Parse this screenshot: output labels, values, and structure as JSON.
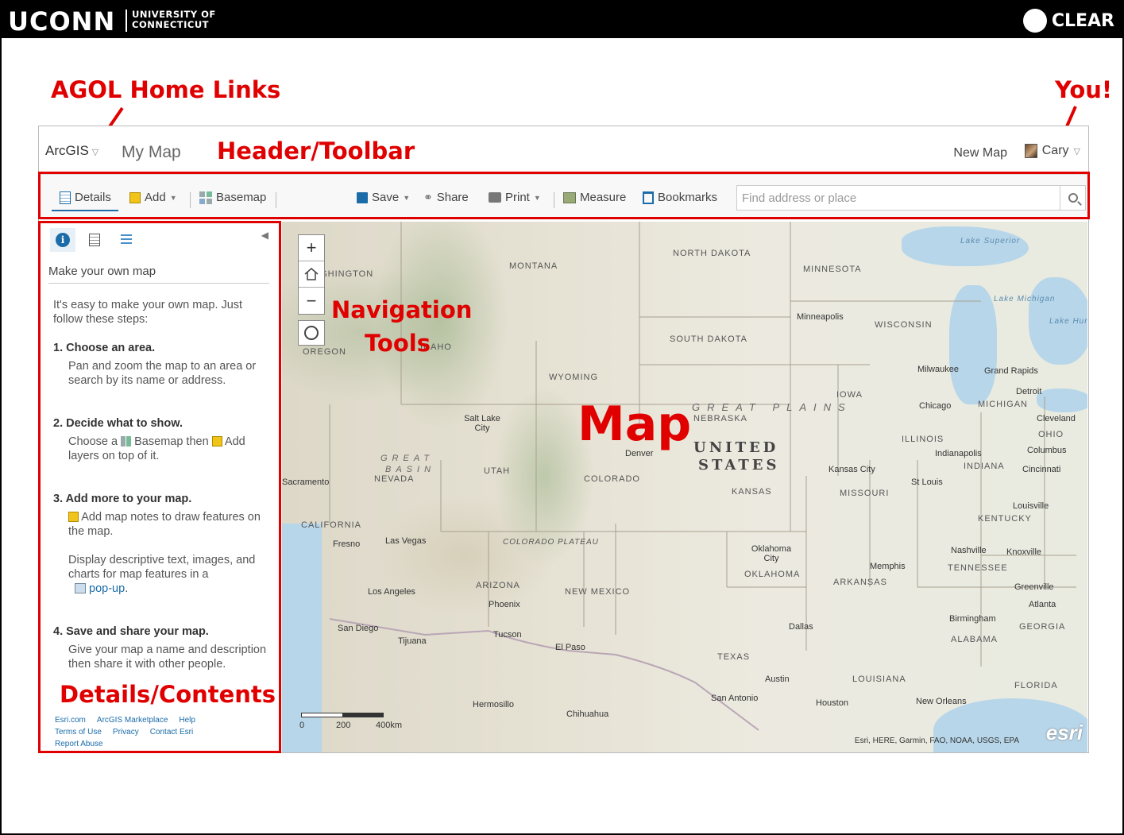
{
  "slide": {
    "brand_main": "UCONN",
    "brand_sub_line1": "UNIVERSITY OF",
    "brand_sub_line2": "CONNECTICUT",
    "clear_logo": "CLEAR"
  },
  "annotations": {
    "agol": "AGOL Home Links",
    "you": "You!",
    "header": "Header/Toolbar",
    "nav": "Navigation",
    "nav2": "Tools",
    "map": "Map",
    "details": "Details/Contents"
  },
  "header": {
    "arcgis": "ArcGIS",
    "title": "My Map",
    "new_map": "New Map",
    "user": "Cary"
  },
  "toolbar": {
    "details": "Details",
    "add": "Add",
    "basemap": "Basemap",
    "save": "Save",
    "share": "Share",
    "print": "Print",
    "measure": "Measure",
    "bookmarks": "Bookmarks",
    "search_placeholder": "Find address or place"
  },
  "sidebar": {
    "title": "Make your own map",
    "intro": "It's easy to make your own map. Just follow these steps:",
    "step1_h": "1. Choose an area.",
    "step1_p": "Pan and zoom the map to an area or search by its name or address.",
    "step2_h": "2. Decide what to show.",
    "step2_a": "Choose a",
    "step2_b": "Basemap then",
    "step2_c": "Add layers on top of it.",
    "step3_h": "3. Add more to your map.",
    "step3_p1": "Add map notes to draw features on the map.",
    "step3_p2": "Display descriptive text, images, and charts for map features in a",
    "step3_link": "pop-up",
    "step4_h": "4. Save and share your map.",
    "step4_p": "Give your map a name and description then share it with other people.",
    "footer": [
      "Esri.com",
      "ArcGIS Marketplace",
      "Help",
      "Terms of Use",
      "Privacy",
      "Contact Esri",
      "Report Abuse"
    ]
  },
  "map": {
    "states": [
      "NORTH DAKOTA",
      "MONTANA",
      "MINNESOTA",
      "WASHINGTON",
      "SOUTH DAKOTA",
      "WISCONSIN",
      "OREGON",
      "IDAHO",
      "WYOMING",
      "IOWA",
      "NEBRASKA",
      "MICHIGAN",
      "ILLINOIS",
      "OHIO",
      "INDIANA",
      "NEVADA",
      "UTAH",
      "COLORADO",
      "KANSAS",
      "MISSOURI",
      "KENTUCKY",
      "CALIFORNIA",
      "OKLAHOMA",
      "TENNESSEE",
      "ARKANSAS",
      "ARIZONA",
      "NEW MEXICO",
      "ALABAMA",
      "GEORGIA",
      "TEXAS",
      "LOUISIANA",
      "FLORIDA",
      "COLORADO PLATEAU"
    ],
    "cities": [
      "Minneapolis",
      "Milwaukee",
      "Grand Rapids",
      "Detroit",
      "Chicago",
      "Cleveland",
      "Columbus",
      "Indianapolis",
      "Cincinnati",
      "Salt Lake City",
      "Denver",
      "Kansas City",
      "St Louis",
      "Louisville",
      "Sacramento",
      "Fresno",
      "Las Vegas",
      "Oklahoma City",
      "Nashville",
      "Knoxville",
      "Memphis",
      "Los Angeles",
      "Phoenix",
      "Greenville",
      "Atlanta",
      "Birmingham",
      "San Diego",
      "Tijuana",
      "Tucson",
      "El Paso",
      "Dallas",
      "Austin",
      "Houston",
      "San Antonio",
      "New Orleans",
      "Hermosillo",
      "Chihuahua"
    ],
    "big1": "UNITED",
    "big2": "STATES",
    "great": "GREAT",
    "plains": "PLAINS",
    "great_basin1": "GREAT",
    "great_basin2": "BASIN",
    "lake_superior": "Lake Superior",
    "lake_michigan": "Lake Michigan",
    "lake_huron": "Lake Huron",
    "scale_0": "0",
    "scale_200": "200",
    "scale_400": "400km",
    "attribution": "Esri, HERE, Garmin, FAO, NOAA, USGS, EPA",
    "esri": "esri"
  }
}
